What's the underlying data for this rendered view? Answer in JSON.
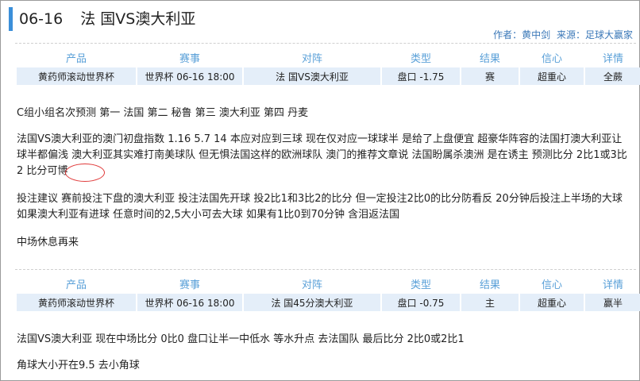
{
  "header": {
    "date": "06-16",
    "match": "法 国VS澳大利亚",
    "author_label": "作者：黄中剑",
    "source_label": "来源：足球大赢家"
  },
  "table_headers": [
    "产品",
    "赛事",
    "对阵",
    "类型",
    "结果",
    "信心",
    "详情"
  ],
  "table1_row": [
    "黄药师滚动世界杯",
    "世界杯 06-16 18:00",
    "法 国VS澳大利亚",
    "盘口 -1.75",
    "赛",
    "超重心",
    "全蕨"
  ],
  "table2_row": [
    "黄药师滚动世界杯",
    "世界杯 06-16 18:00",
    "法 国45分澳大利亚",
    "盘口 -0.75",
    "主",
    "超重心",
    "赢半"
  ],
  "paragraphs": {
    "p1": "C组小组名次预测   第一  法国   第二  秘鲁  第三  澳大利亚  第四 丹麦",
    "p2": "法国VS澳大利亚的澳门初盘指数  1.16  5.7  14 本应对应到三球 现在仅对应一球球半 是给了上盘便宜  超豪华阵容的法国打澳大利亚让球半都偏浅  澳大利亚其实难打南美球队 但无惧法国这样的欧洲球队  澳门的推荐文章说 法国盼属杀澳洲  是在诱主  预测比分  2比1或3比2  比分可博",
    "p3": "投注建议  赛前投注下盘的澳大利亚 投注法国先开球  投2比1和3比2的比分 但一定投注2比0的比分防看反  20分钟后投注上半场的大球  如果澳大利亚有进球 任意时间的2,5大小可去大球  如果有1比0到70分钟  含泪返法国",
    "p4": "中场休息再来",
    "p5": "法国VS澳大利亚  现在中场比分  0比0  盘口让半一中低水  等水升点 去法国队  最后比分   2比0或2比1",
    "p6": "角球大小开在9.5  去小角球"
  }
}
